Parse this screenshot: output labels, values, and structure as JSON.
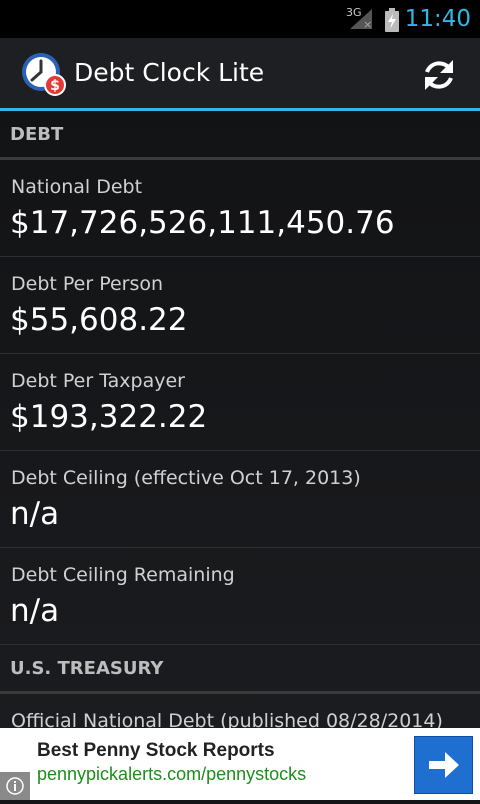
{
  "status_bar": {
    "network": "3G",
    "time": "11:40"
  },
  "app": {
    "title": "Debt Clock Lite"
  },
  "colors": {
    "accent": "#33b5e5",
    "ad_url": "#1a8f1a",
    "ad_button": "#1f6fd0"
  },
  "sections": {
    "debt": {
      "header": "DEBT",
      "rows": [
        {
          "label": "National Debt",
          "value": "$17,726,526,111,450.76"
        },
        {
          "label": "Debt Per Person",
          "value": "$55,608.22"
        },
        {
          "label": "Debt Per Taxpayer",
          "value": "$193,322.22"
        },
        {
          "label": "Debt Ceiling (effective Oct 17, 2013)",
          "value": "n/a"
        },
        {
          "label": "Debt Ceiling Remaining",
          "value": "n/a"
        }
      ]
    },
    "treasury": {
      "header": "U.S. TREASURY",
      "rows": [
        {
          "label": "Official National Debt (published 08/28/2014)"
        }
      ]
    }
  },
  "ad": {
    "title": "Best Penny Stock Reports",
    "url": "pennypickalerts.com/pennystocks",
    "icons": [
      "arrow-right-icon",
      "info-icon"
    ]
  }
}
